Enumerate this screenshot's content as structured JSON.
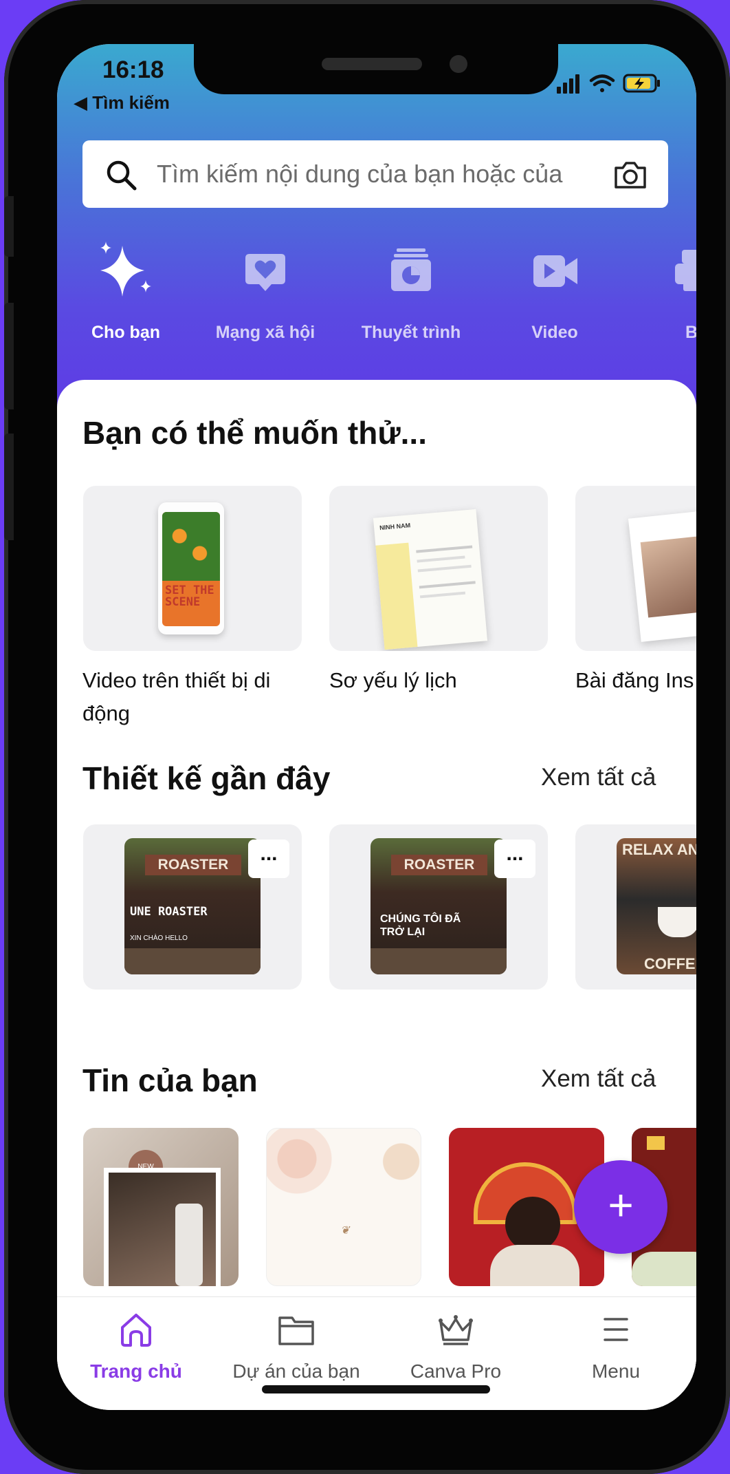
{
  "status": {
    "time": "16:18",
    "back_label": "◀ Tìm kiếm"
  },
  "search": {
    "placeholder": "Tìm kiếm nội dung của bạn hoặc của"
  },
  "categories": [
    {
      "label": "Cho bạn",
      "icon": "sparkle-icon"
    },
    {
      "label": "Mạng xã hội",
      "icon": "heart-chat-icon"
    },
    {
      "label": "Thuyết trình",
      "icon": "presentation-icon"
    },
    {
      "label": "Video",
      "icon": "video-camera-icon"
    },
    {
      "label": "Bả",
      "icon": "print-icon"
    }
  ],
  "suggest": {
    "title": "Bạn có thể muốn thử...",
    "items": [
      {
        "label_line1": "Video trên thiết bị di",
        "label_line2": "động"
      },
      {
        "label_line1": "Sơ yếu lý lịch",
        "label_line2": ""
      },
      {
        "label_line1": "Bài đăng Ins",
        "label_line2": ""
      }
    ],
    "phone_art_text": "SET THE SCENE",
    "resume_art_text": "NINH NAM"
  },
  "recent": {
    "title": "Thiết kế gần đây",
    "see_all": "Xem tất cả",
    "items": [
      {
        "top": "ROASTER",
        "caption": "UNE ROASTER",
        "sub": "XIN CHÀO HELLO",
        "more": "..."
      },
      {
        "top": "ROASTER",
        "caption": "CHÚNG TÔI ĐÃ TRỞ LẠI",
        "sub": "",
        "more": "..."
      },
      {
        "top": "RELAX AND",
        "caption": "COFFEE",
        "sub": "",
        "more": ""
      }
    ]
  },
  "stories": {
    "title": "Tin của bạn",
    "see_all": "Xem tất cả",
    "badge": "NEW"
  },
  "fab": {
    "label": "+"
  },
  "tabs": [
    {
      "label": "Trang chủ",
      "icon": "home-icon",
      "active": true
    },
    {
      "label": "Dự án của bạn",
      "icon": "folder-icon",
      "active": false
    },
    {
      "label": "Canva Pro",
      "icon": "crown-icon",
      "active": false
    },
    {
      "label": "Menu",
      "icon": "menu-icon",
      "active": false
    }
  ],
  "colors": {
    "accent": "#7b2fe6",
    "tab_active": "#8a3ce6",
    "background": "#6b3df5"
  }
}
